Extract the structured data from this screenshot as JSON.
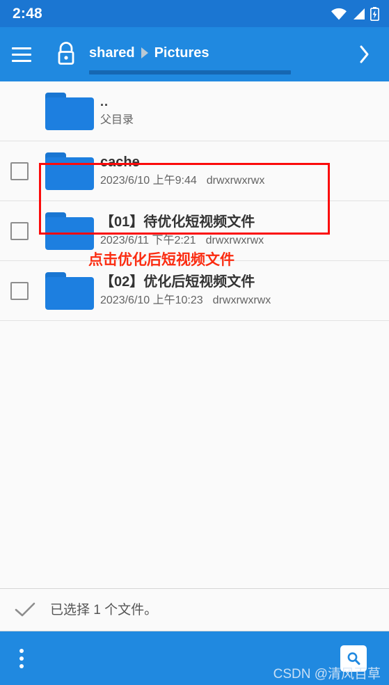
{
  "status_bar": {
    "time": "2:48",
    "icons": [
      "wifi-icon",
      "cellular-signal-icon",
      "battery-charging-icon"
    ]
  },
  "app_bar": {
    "menu_icon": "hamburger-menu-icon",
    "lock_icon": "unlocked-padlock-icon",
    "breadcrumb": {
      "root": "shared",
      "separator_icon": "breadcrumb-separator-icon",
      "current": "Pictures"
    },
    "forward_icon": "chevron-right-icon"
  },
  "file_list": {
    "rows": [
      {
        "name": "..",
        "subtitle": "父目录",
        "date": "",
        "permissions": "",
        "has_checkbox": false,
        "checked": false,
        "icon": "folder-icon",
        "highlighted": false
      },
      {
        "name": "cache",
        "subtitle": "",
        "date": "2023/6/10 上午9:44",
        "permissions": "drwxrwxrwx",
        "has_checkbox": true,
        "checked": false,
        "icon": "folder-icon",
        "highlighted": false
      },
      {
        "name": "【01】待优化短视频文件",
        "subtitle": "",
        "date": "2023/6/11 下午2:21",
        "permissions": "drwxrwxrwx",
        "has_checkbox": true,
        "checked": false,
        "icon": "folder-icon",
        "highlighted": false
      },
      {
        "name": "【02】优化后短视频文件",
        "subtitle": "",
        "date": "2023/6/10 上午10:23",
        "permissions": "drwxrwxrwx",
        "has_checkbox": true,
        "checked": false,
        "icon": "folder-icon",
        "highlighted": true
      }
    ],
    "annotation": "点击优化后短视频文件"
  },
  "selection_bar": {
    "check_icon": "checkmark-icon",
    "text": "已选择 1 个文件。"
  },
  "bottom_bar": {
    "overflow_icon": "overflow-menu-icon",
    "search_icon": "search-icon",
    "watermark": "CSDN @清风百草"
  },
  "colors": {
    "status_bar_blue": "#1b76d2",
    "app_bar_blue": "#2089e0",
    "folder_blue": "#1d7fe0",
    "annotation_red": "#fb2c11",
    "highlight_red": "#fb0b0b",
    "list_background": "#fafafa"
  }
}
